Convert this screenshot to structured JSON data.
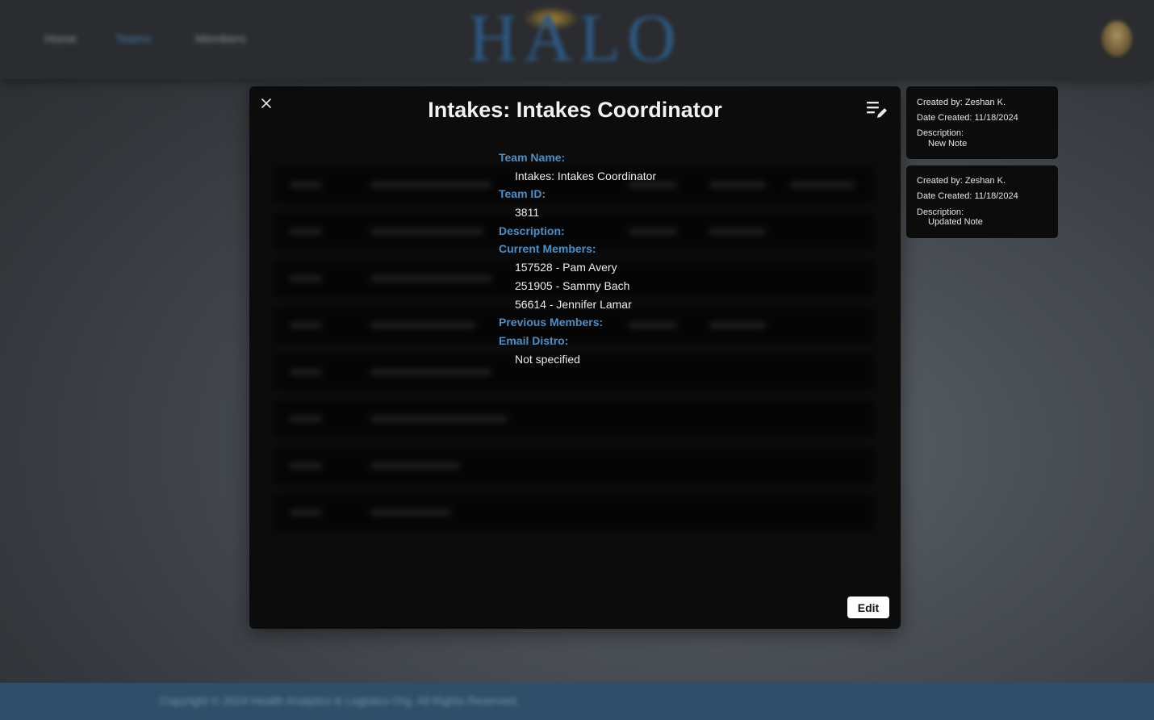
{
  "background_app": {
    "nav_links": [
      "Home",
      "Teams",
      "Members"
    ],
    "logo_text": "HALO",
    "footer_text": "Copyright © 2024 Health Analytics & Logistics Org. All Rights Reserved."
  },
  "modal": {
    "title": "Intakes: Intakes Coordinator",
    "close_icon": "close-icon",
    "notes_icon": "notes-edit-icon",
    "fields": {
      "team_name_label": "Team Name:",
      "team_name_value": "Intakes: Intakes Coordinator",
      "team_id_label": "Team ID:",
      "team_id_value": "3811",
      "description_label": "Description:",
      "current_members_label": "Current Members:",
      "current_members": [
        "157528 - Pam Avery",
        "251905 - Sammy Bach",
        "56614 - Jennifer Lamar"
      ],
      "previous_members_label": "Previous Members:",
      "email_distro_label": "Email Distro:",
      "email_distro_value": "Not specified"
    },
    "edit_label": "Edit"
  },
  "notes": [
    {
      "created_by": "Created by: Zeshan K.",
      "date_created": "Date Created: 11/18/2024",
      "description_label": "Description:",
      "description": "New Note"
    },
    {
      "created_by": "Created by: Zeshan K.",
      "date_created": "Date Created: 11/18/2024",
      "description_label": "Description:",
      "description": "Updated Note"
    }
  ],
  "colors": {
    "label_blue": "#4a90c8",
    "modal_bg": "#0c0c0c",
    "footer_bg": "#2e4e69"
  }
}
